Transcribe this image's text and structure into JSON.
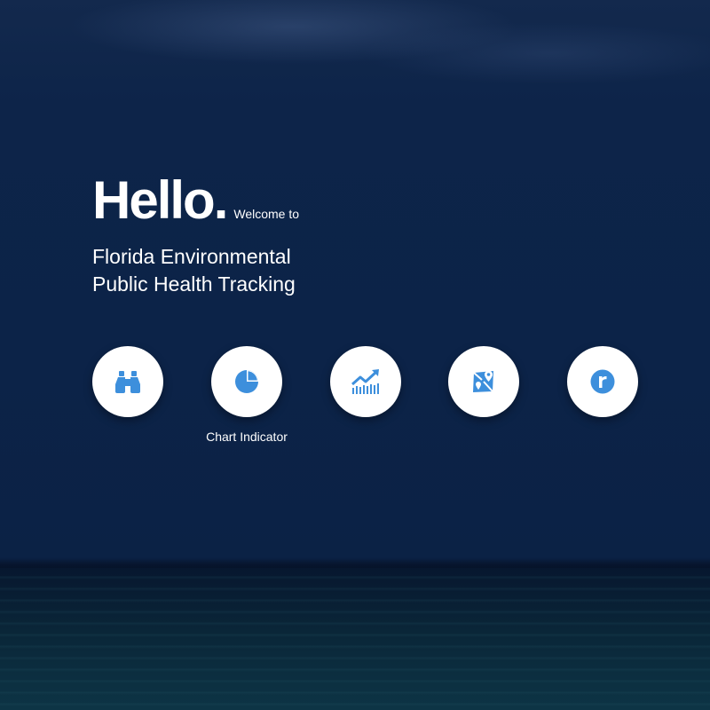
{
  "hero": {
    "greeting": "Hello.",
    "welcome": "Welcome to",
    "title_line1": "Florida Environmental",
    "title_line2": "Public Health Tracking"
  },
  "nav": {
    "items": [
      {
        "icon": "binoculars-icon",
        "label": ""
      },
      {
        "icon": "pie-chart-icon",
        "label": "Chart Indicator"
      },
      {
        "icon": "trend-chart-icon",
        "label": ""
      },
      {
        "icon": "map-marker-icon",
        "label": ""
      },
      {
        "icon": "r-letter-icon",
        "label": ""
      }
    ]
  },
  "colors": {
    "icon_blue": "#3d8fdc",
    "circle_bg": "#ffffff",
    "background_navy": "#0c2348",
    "text": "#ffffff"
  }
}
